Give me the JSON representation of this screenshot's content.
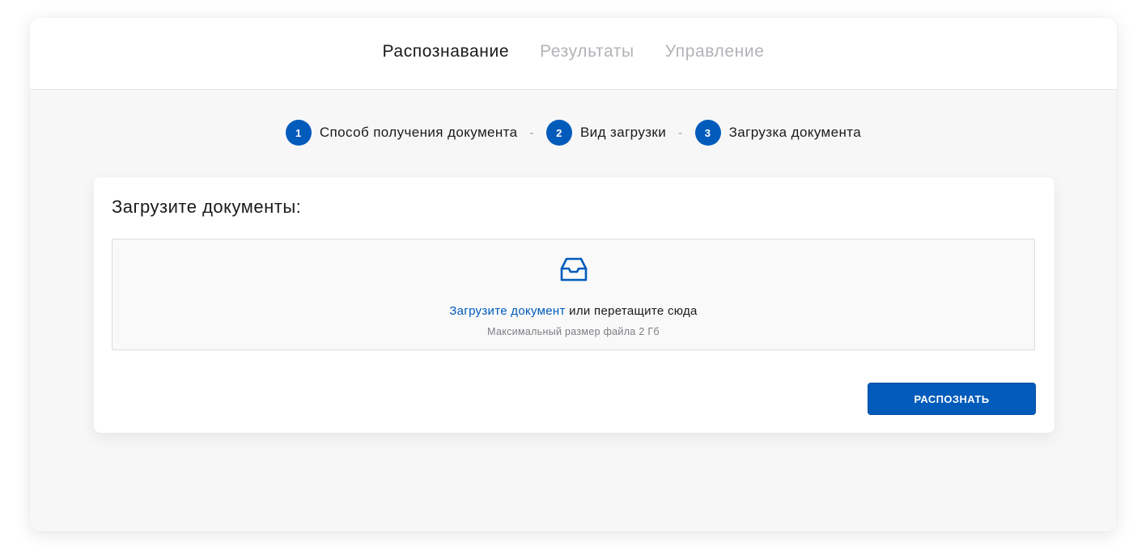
{
  "nav": {
    "tabs": [
      {
        "label": "Распознавание",
        "active": true
      },
      {
        "label": "Результаты",
        "active": false
      },
      {
        "label": "Управление",
        "active": false
      }
    ]
  },
  "stepper": {
    "separator": "-",
    "steps": [
      {
        "number": "1",
        "label": "Способ получения документа"
      },
      {
        "number": "2",
        "label": "Вид загрузки"
      },
      {
        "number": "3",
        "label": "Загрузка документа"
      }
    ]
  },
  "upload": {
    "title": "Загрузите документы:",
    "icon": "inbox-icon",
    "link_text": "Загрузите документ",
    "rest_text": " или перетащите сюда",
    "hint": "Максимальный размер файла 2 Гб",
    "button_label": "РАСПОЗНАТЬ"
  },
  "colors": {
    "accent": "#005bbb",
    "inactive_tab": "#b3b3b8",
    "background": "#f7f7f8"
  }
}
